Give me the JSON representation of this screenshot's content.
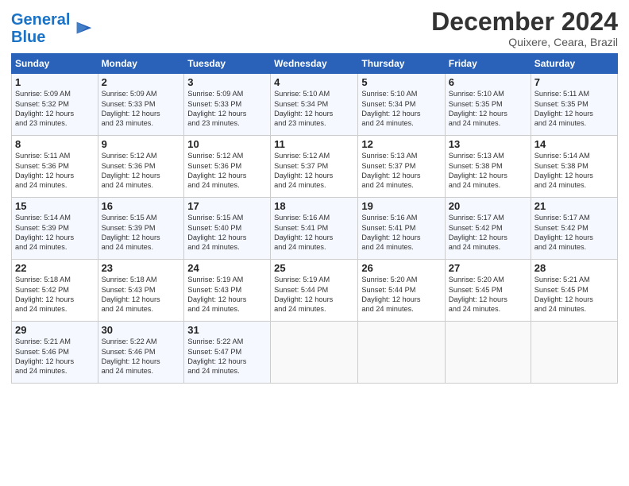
{
  "logo": {
    "line1": "General",
    "line2": "Blue"
  },
  "title": "December 2024",
  "subtitle": "Quixere, Ceara, Brazil",
  "days_of_week": [
    "Sunday",
    "Monday",
    "Tuesday",
    "Wednesday",
    "Thursday",
    "Friday",
    "Saturday"
  ],
  "weeks": [
    [
      {
        "day": "1",
        "info": "Sunrise: 5:09 AM\nSunset: 5:32 PM\nDaylight: 12 hours\nand 23 minutes."
      },
      {
        "day": "2",
        "info": "Sunrise: 5:09 AM\nSunset: 5:33 PM\nDaylight: 12 hours\nand 23 minutes."
      },
      {
        "day": "3",
        "info": "Sunrise: 5:09 AM\nSunset: 5:33 PM\nDaylight: 12 hours\nand 23 minutes."
      },
      {
        "day": "4",
        "info": "Sunrise: 5:10 AM\nSunset: 5:34 PM\nDaylight: 12 hours\nand 23 minutes."
      },
      {
        "day": "5",
        "info": "Sunrise: 5:10 AM\nSunset: 5:34 PM\nDaylight: 12 hours\nand 24 minutes."
      },
      {
        "day": "6",
        "info": "Sunrise: 5:10 AM\nSunset: 5:35 PM\nDaylight: 12 hours\nand 24 minutes."
      },
      {
        "day": "7",
        "info": "Sunrise: 5:11 AM\nSunset: 5:35 PM\nDaylight: 12 hours\nand 24 minutes."
      }
    ],
    [
      {
        "day": "8",
        "info": "Sunrise: 5:11 AM\nSunset: 5:36 PM\nDaylight: 12 hours\nand 24 minutes."
      },
      {
        "day": "9",
        "info": "Sunrise: 5:12 AM\nSunset: 5:36 PM\nDaylight: 12 hours\nand 24 minutes."
      },
      {
        "day": "10",
        "info": "Sunrise: 5:12 AM\nSunset: 5:36 PM\nDaylight: 12 hours\nand 24 minutes."
      },
      {
        "day": "11",
        "info": "Sunrise: 5:12 AM\nSunset: 5:37 PM\nDaylight: 12 hours\nand 24 minutes."
      },
      {
        "day": "12",
        "info": "Sunrise: 5:13 AM\nSunset: 5:37 PM\nDaylight: 12 hours\nand 24 minutes."
      },
      {
        "day": "13",
        "info": "Sunrise: 5:13 AM\nSunset: 5:38 PM\nDaylight: 12 hours\nand 24 minutes."
      },
      {
        "day": "14",
        "info": "Sunrise: 5:14 AM\nSunset: 5:38 PM\nDaylight: 12 hours\nand 24 minutes."
      }
    ],
    [
      {
        "day": "15",
        "info": "Sunrise: 5:14 AM\nSunset: 5:39 PM\nDaylight: 12 hours\nand 24 minutes."
      },
      {
        "day": "16",
        "info": "Sunrise: 5:15 AM\nSunset: 5:39 PM\nDaylight: 12 hours\nand 24 minutes."
      },
      {
        "day": "17",
        "info": "Sunrise: 5:15 AM\nSunset: 5:40 PM\nDaylight: 12 hours\nand 24 minutes."
      },
      {
        "day": "18",
        "info": "Sunrise: 5:16 AM\nSunset: 5:41 PM\nDaylight: 12 hours\nand 24 minutes."
      },
      {
        "day": "19",
        "info": "Sunrise: 5:16 AM\nSunset: 5:41 PM\nDaylight: 12 hours\nand 24 minutes."
      },
      {
        "day": "20",
        "info": "Sunrise: 5:17 AM\nSunset: 5:42 PM\nDaylight: 12 hours\nand 24 minutes."
      },
      {
        "day": "21",
        "info": "Sunrise: 5:17 AM\nSunset: 5:42 PM\nDaylight: 12 hours\nand 24 minutes."
      }
    ],
    [
      {
        "day": "22",
        "info": "Sunrise: 5:18 AM\nSunset: 5:42 PM\nDaylight: 12 hours\nand 24 minutes."
      },
      {
        "day": "23",
        "info": "Sunrise: 5:18 AM\nSunset: 5:43 PM\nDaylight: 12 hours\nand 24 minutes."
      },
      {
        "day": "24",
        "info": "Sunrise: 5:19 AM\nSunset: 5:43 PM\nDaylight: 12 hours\nand 24 minutes."
      },
      {
        "day": "25",
        "info": "Sunrise: 5:19 AM\nSunset: 5:44 PM\nDaylight: 12 hours\nand 24 minutes."
      },
      {
        "day": "26",
        "info": "Sunrise: 5:20 AM\nSunset: 5:44 PM\nDaylight: 12 hours\nand 24 minutes."
      },
      {
        "day": "27",
        "info": "Sunrise: 5:20 AM\nSunset: 5:45 PM\nDaylight: 12 hours\nand 24 minutes."
      },
      {
        "day": "28",
        "info": "Sunrise: 5:21 AM\nSunset: 5:45 PM\nDaylight: 12 hours\nand 24 minutes."
      }
    ],
    [
      {
        "day": "29",
        "info": "Sunrise: 5:21 AM\nSunset: 5:46 PM\nDaylight: 12 hours\nand 24 minutes."
      },
      {
        "day": "30",
        "info": "Sunrise: 5:22 AM\nSunset: 5:46 PM\nDaylight: 12 hours\nand 24 minutes."
      },
      {
        "day": "31",
        "info": "Sunrise: 5:22 AM\nSunset: 5:47 PM\nDaylight: 12 hours\nand 24 minutes."
      },
      {
        "day": "",
        "info": ""
      },
      {
        "day": "",
        "info": ""
      },
      {
        "day": "",
        "info": ""
      },
      {
        "day": "",
        "info": ""
      }
    ]
  ]
}
